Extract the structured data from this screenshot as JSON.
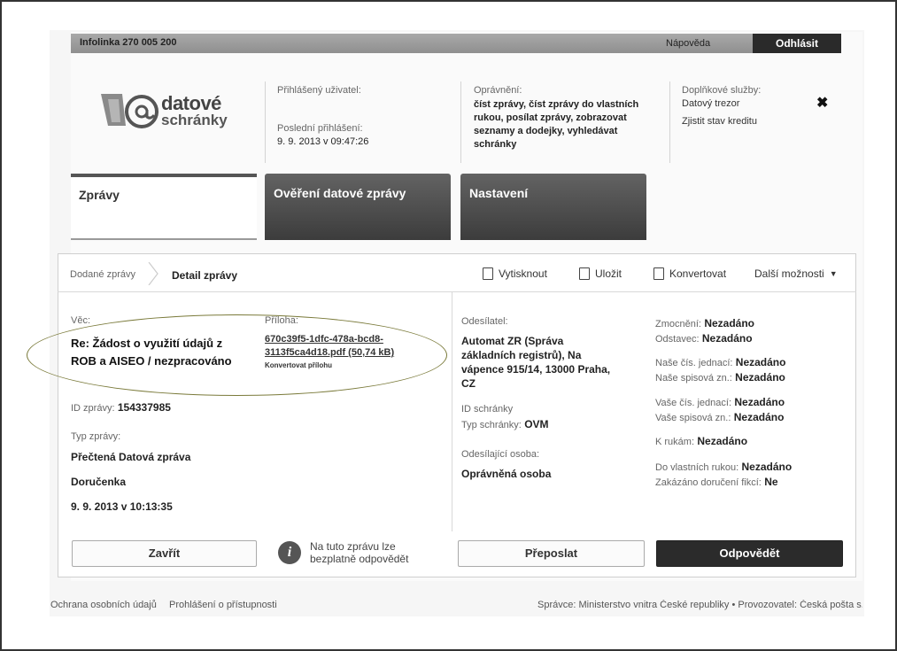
{
  "topbar": {
    "infoline": "Infolinka 270 005 200",
    "help": "Nápověda",
    "logout": "Odhlásit"
  },
  "logo": {
    "line1": "datové",
    "line2": "schránky"
  },
  "user": {
    "label": "Přihlášený uživatel:",
    "last_login_label": "Poslední přihlášení:",
    "last_login": "9. 9. 2013 v 09:47:26"
  },
  "permissions": {
    "label": "Oprávnění:",
    "text": "číst zprávy, číst zprávy do vlastních rukou, posílat zprávy, zobrazovat seznamy a dodejky, vyhledávat schránky"
  },
  "extra": {
    "label": "Doplňkové služby:",
    "vault": "Datový trezor",
    "credit": "Zjistit stav kreditu"
  },
  "close_icon": "close-icon",
  "tabs": [
    {
      "label": "Zprávy"
    },
    {
      "label": "Ověření datové zprávy"
    },
    {
      "label": "Nastavení"
    }
  ],
  "breadcrumb": {
    "parent": "Dodané zprávy",
    "current": "Detail zprávy"
  },
  "actions": {
    "print": "Vytisknout",
    "save": "Uložit",
    "convert": "Konvertovat",
    "more": "Další možnosti"
  },
  "message": {
    "subject_label": "Věc:",
    "subject": "Re: Žádost o využití údajů z ROB a AISEO / nezpracováno",
    "attachment_label": "Příloha:",
    "attachment_line1": "670c39f5-1dfc-478a-bcd8-",
    "attachment_line2": "3113f5ca4d18.pdf (50,74 kB)",
    "convert_attachment": "Konvertovat přílohu",
    "id_label": "ID zprávy:",
    "id": "154337985",
    "type_label": "Typ zprávy:",
    "type1": "Přečtená Datová zpráva",
    "type2": "Doručenka",
    "date": "9. 9. 2013 v 10:13:35"
  },
  "sender": {
    "label": "Odesílatel:",
    "line1": "Automat ZR (Správa",
    "line2": "základních registrů), Na",
    "line3": "vápence 915/14, 13000 Praha,",
    "line4": "CZ",
    "box_id_label": "ID schránky",
    "box_type_label": "Typ schránky:",
    "box_type": "OVM",
    "person_label": "Odesílající osoba:",
    "person": "Oprávněná osoba"
  },
  "details": {
    "auth_label": "Zmocnění:",
    "auth": "Nezadáno",
    "para_label": "Odstavec:",
    "para": "Nezadáno",
    "our_ref_label": "Naše čís. jednací:",
    "our_ref": "Nezadáno",
    "our_file_label": "Naše spisová zn.:",
    "our_file": "Nezadáno",
    "your_ref_label": "Vaše čís. jednací:",
    "your_ref": "Nezadáno",
    "your_file_label": "Vaše spisová zn.:",
    "your_file": "Nezadáno",
    "attn_label": "K rukám:",
    "attn": "Nezadáno",
    "own_hands_label": "Do vlastních rukou:",
    "own_hands": "Nezadáno",
    "fiction_label": "Zakázáno doručení fikcí:",
    "fiction": "Ne"
  },
  "buttons": {
    "close": "Zavřít",
    "info": "Na tuto zprávu lze bezplatně odpovědět",
    "forward": "Přeposlat",
    "reply": "Odpovědět"
  },
  "footer": {
    "privacy": "Ochrana osobních údajů",
    "accessibility": "Prohlášení o přístupnosti",
    "admin": "Správce: Ministerstvo vnitra České republiky • Provozovatel: Česká pošta s. p."
  }
}
